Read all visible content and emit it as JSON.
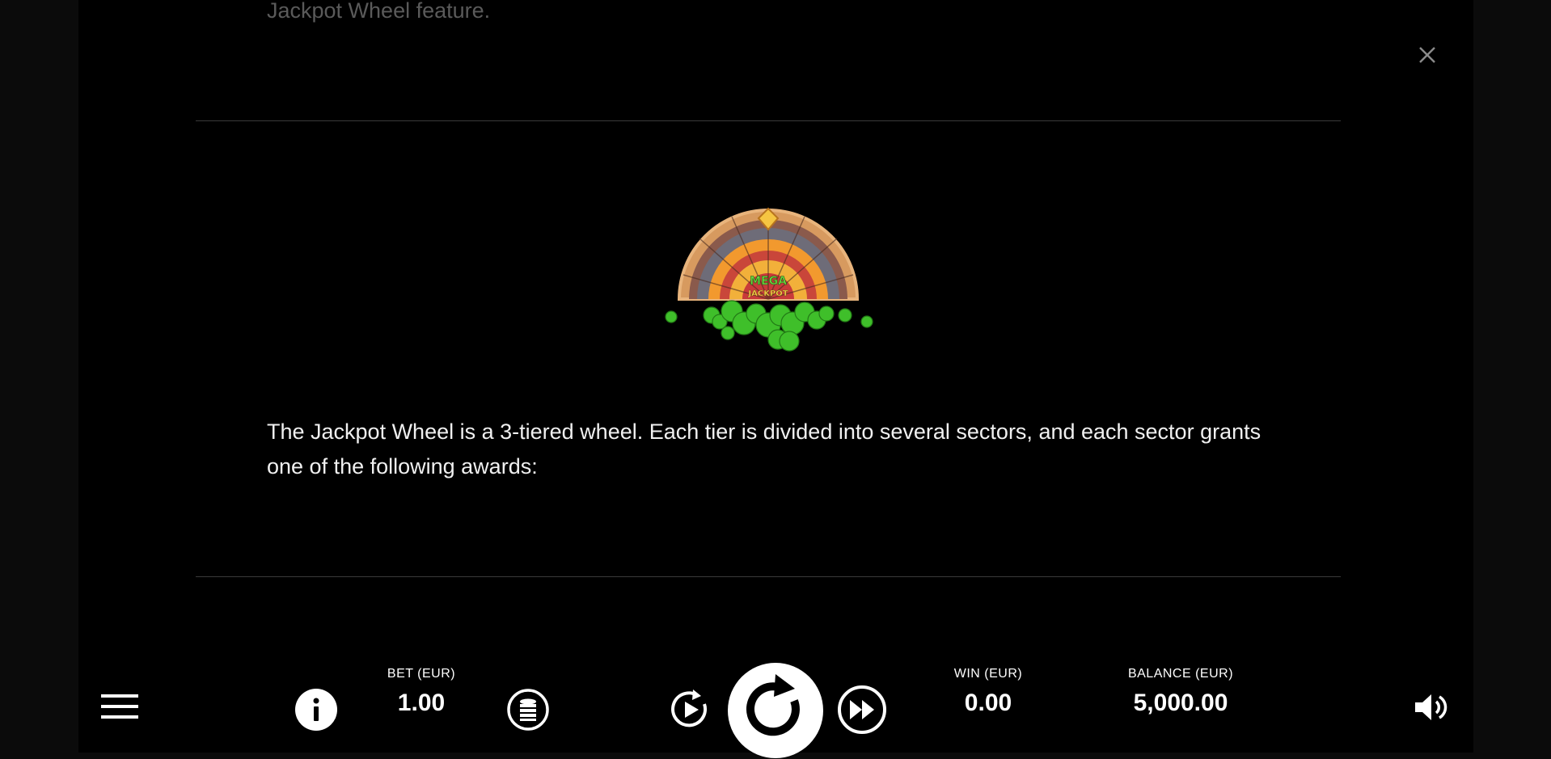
{
  "paytable": {
    "faded_heading": "Jackpot Wheel feature.",
    "body_text": "The Jackpot Wheel is a 3-tiered wheel. Each tier is divided into several sectors, and each sector grants one of the following awards:",
    "wheel_hub_label_1": "MEGA",
    "wheel_hub_label_2": "JACKPOT"
  },
  "controls": {
    "bet_label": "BET (EUR)",
    "bet_value": "1.00",
    "win_label": "WIN (EUR)",
    "win_value": "0.00",
    "balance_label": "BALANCE (EUR)",
    "balance_value": "5,000.00"
  },
  "icons": [
    "menu-icon",
    "info-icon",
    "coin-stack-icon",
    "autoplay-icon",
    "spin-icon",
    "turbo-icon",
    "sound-icon",
    "close-icon"
  ],
  "colors": {
    "background": "#000000",
    "text": "#ffffff",
    "divider": "#3a3a3a",
    "clover": "#3fbf2a",
    "wheel_orange": "#f2992e"
  }
}
